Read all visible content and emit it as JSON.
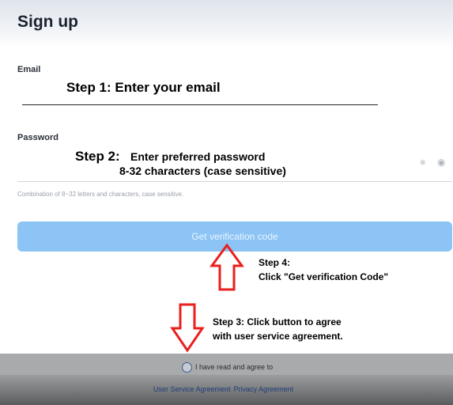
{
  "header": {
    "title": "Sign up"
  },
  "email": {
    "label": "Email",
    "annotation": "Step 1: Enter your email"
  },
  "password": {
    "label": "Password",
    "annotation_lead": "Step 2:",
    "annotation_rest": "Enter preferred password",
    "annotation_line2": "8-32 characters (case sensitive)",
    "hint": "Combination of 8~32 letters and characters, case sensitive.",
    "clear_glyph": "⊗",
    "eye_glyph": "◉"
  },
  "verify_button": {
    "label": "Get verification code"
  },
  "step4": {
    "line1": "Step 4:",
    "line2": "Click \"Get verification Code\""
  },
  "step3": {
    "line1": "Step 3: Click button to agree",
    "line2": "with user service agreement."
  },
  "agreement": {
    "text": "I have read and agree to",
    "links": [
      "User Service Agreement",
      "Privacy Agreement"
    ]
  },
  "colors": {
    "button": "#8cc4f5",
    "arrow": "#e8201e",
    "radio_border": "#3b5a99"
  }
}
